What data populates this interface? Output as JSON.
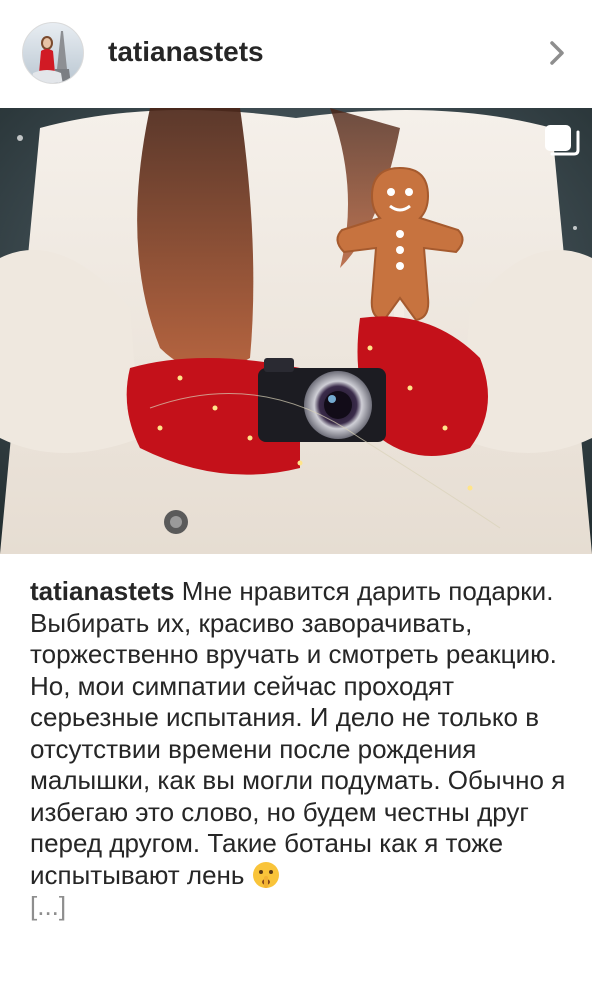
{
  "post": {
    "username": "tatianastets",
    "caption_username": "tatianastets",
    "caption_text": " Мне нравится дарить подарки. Выбирать их, красиво заворачивать, торжественно вручать и смотреть реакцию. Но, мои симпатии сейчас проходят серьезные испытания. И дело не только в отсутствии времени после рождения малышки, как вы могли подумать. Обычно я избегаю это слово, но будем честны друг перед другом. Такие ботаны как я тоже испытывают лень ",
    "caption_more": "[...]",
    "emoji": "shushing-face",
    "icons": {
      "chevron": "chevron-right-icon",
      "multi": "carousel-multiple-icon"
    }
  }
}
